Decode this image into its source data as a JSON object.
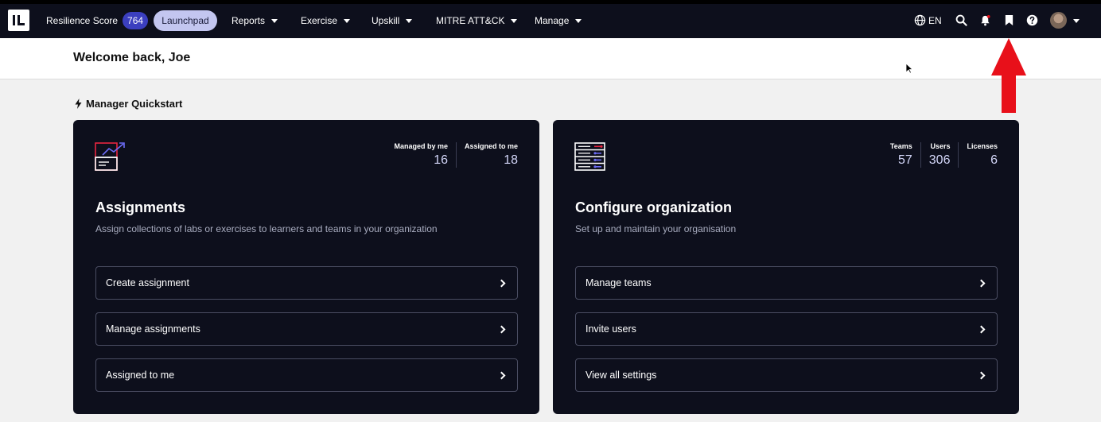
{
  "nav": {
    "resilience_label": "Resilience Score",
    "resilience_score": "764",
    "launchpad": "Launchpad",
    "reports": "Reports",
    "exercise": "Exercise",
    "upskill": "Upskill",
    "mitre": "MITRE ATT&CK",
    "manage": "Manage",
    "language": "EN"
  },
  "icons": [
    "globe-icon",
    "search-icon",
    "bell-icon",
    "bookmark-icon",
    "help-icon",
    "avatar",
    "chevron-down-icon",
    "bolt-icon",
    "chevron-right-icon"
  ],
  "header": {
    "welcome": "Welcome back, Joe"
  },
  "quickstart": {
    "title": "Manager Quickstart"
  },
  "assignments": {
    "title": "Assignments",
    "description": "Assign collections of labs or exercises to learners and teams in your organization",
    "stats": [
      {
        "label": "Managed by me",
        "value": "16"
      },
      {
        "label": "Assigned to me",
        "value": "18"
      }
    ],
    "actions": [
      "Create assignment",
      "Manage assignments",
      "Assigned to me"
    ]
  },
  "organization": {
    "title": "Configure organization",
    "description": "Set up and maintain your organisation",
    "stats": [
      {
        "label": "Teams",
        "value": "57"
      },
      {
        "label": "Users",
        "value": "306"
      },
      {
        "label": "Licenses",
        "value": "6"
      }
    ],
    "actions": [
      "Manage teams",
      "Invite users",
      "View all settings"
    ]
  },
  "colors": {
    "navbar": "#0d0f1c",
    "badge": "#3b3fbf",
    "launchpad": "#c3c6f0",
    "annotation_arrow": "#e8101a"
  }
}
